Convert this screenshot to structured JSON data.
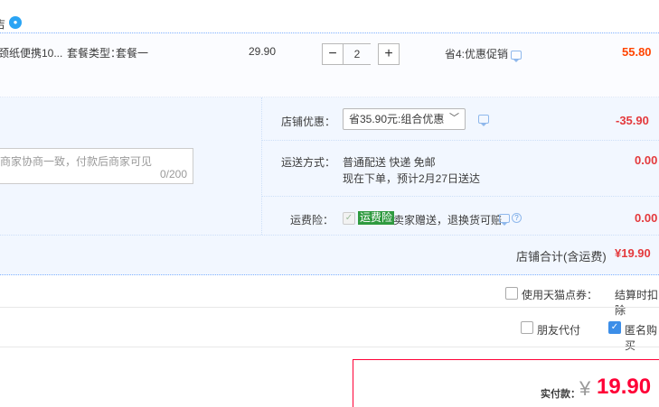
{
  "shop": {
    "name_fragment": "吉",
    "wangwang_icon": "wangwang-icon"
  },
  "item": {
    "title_fragment": "颈纸便携10...",
    "package_label": "套餐类型：",
    "package_value": "套餐一",
    "unit_price": "29.90",
    "quantity": "2",
    "minus_label": "−",
    "plus_label": "+",
    "promo": "省4:优惠促销",
    "subtotal": "55.80"
  },
  "message": {
    "placeholder": "商家协商一致，付款后商家可见",
    "counter": "0/200"
  },
  "shop_discount": {
    "label": "店铺优惠：",
    "selected": "省35.90元:组合优惠",
    "amount": "-35.90"
  },
  "shipping": {
    "label": "运送方式：",
    "method": "普通配送 快递 免邮",
    "eta": "现在下单，预计2月27日送达",
    "amount": "0.00"
  },
  "insurance": {
    "label": "运费险：",
    "tag": "运费险",
    "desc": "卖家赠送，退换货可赔",
    "amount": "0.00"
  },
  "shop_total": {
    "label": "店铺合计(含运费)",
    "value": "¥19.90"
  },
  "coupon": {
    "label": "使用天猫点券：",
    "note": "结算时扣除"
  },
  "options": {
    "friend_pay": "朋友代付",
    "anonymous": "匿名购买"
  },
  "payment": {
    "label": "实付款：",
    "currency": "¥",
    "amount": "19.90"
  },
  "colors": {
    "accent_red": "#ff0036",
    "price_red": "#f40",
    "panel_blue": "#f2f7ff",
    "checkbox_blue": "#3c8ee8"
  }
}
